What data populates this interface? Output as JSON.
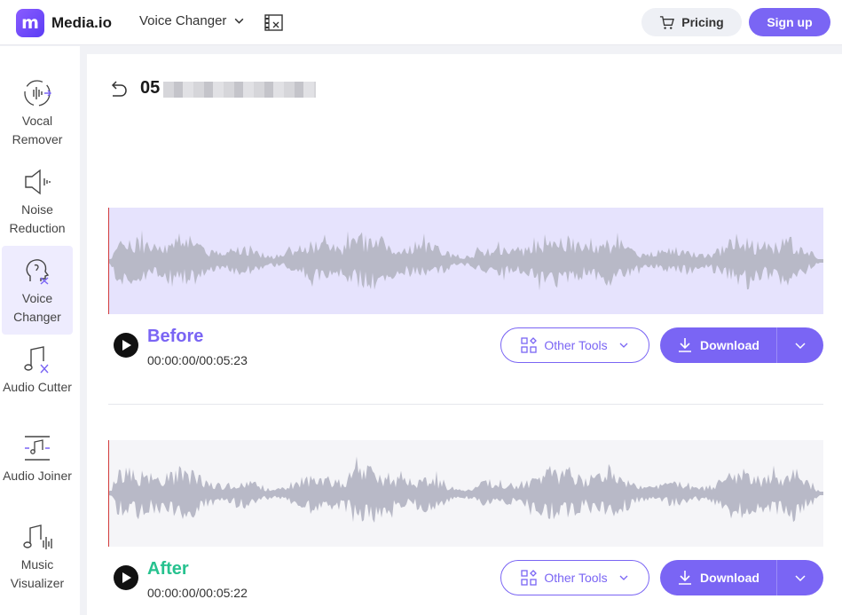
{
  "header": {
    "logo_mark": "m",
    "logo_text": "Media.io",
    "nav_label": "Voice Changer",
    "pricing_label": "Pricing",
    "signup_label": "Sign up"
  },
  "sidebar": {
    "items": [
      {
        "label": "Vocal Remover",
        "icon": "vocal-remover-icon",
        "active": false
      },
      {
        "label": "Noise Reduction",
        "icon": "speaker-icon",
        "active": false
      },
      {
        "label": "Voice Changer",
        "icon": "voice-changer-icon",
        "active": true
      },
      {
        "label": "Audio Cutter",
        "icon": "music-scissors-icon",
        "active": false
      },
      {
        "label": "Audio Joiner",
        "icon": "music-join-icon",
        "active": false
      },
      {
        "label": "Music Visualizer",
        "icon": "music-visualizer-icon",
        "active": false
      }
    ]
  },
  "main": {
    "file_title": "05",
    "before": {
      "label": "Before",
      "time": "00:00:00/00:05:23",
      "other_tools": "Other Tools",
      "download": "Download"
    },
    "after": {
      "label": "After",
      "time": "00:00:00/00:05:22",
      "other_tools": "Other Tools",
      "download": "Download"
    }
  },
  "colors": {
    "accent": "#7a65f4",
    "after_green": "#27c28f",
    "wave": "#b8b9c7",
    "playhead": "#d23c3c"
  }
}
